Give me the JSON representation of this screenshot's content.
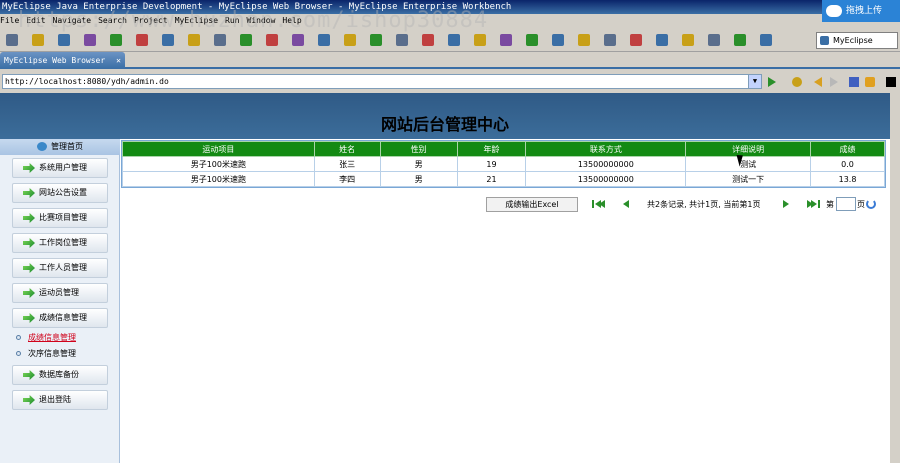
{
  "window": {
    "title": "MyEclipse Java Enterprise Development - MyEclipse Web Browser - MyEclipse Enterprise Workbench",
    "upload_label": "拖拽上传"
  },
  "menubar": [
    "File",
    "Edit",
    "Navigate",
    "Search",
    "Project",
    "MyEclipse",
    "Run",
    "Window",
    "Help"
  ],
  "toolbar": {
    "perspective_label": "MyEclipse"
  },
  "editor": {
    "tab_label": "MyEclipse Web Browser",
    "close_glyph": "✕"
  },
  "browser": {
    "url": "http://localhost:8080/ydh/admin.do"
  },
  "watermark": "https://www.huzhan.com/ishop30884",
  "page": {
    "title": "网站后台管理中心"
  },
  "sidebar": {
    "home_label": "管理首页",
    "menu_items": [
      {
        "label": "系统用户管理"
      },
      {
        "label": "网站公告设置"
      },
      {
        "label": "比赛项目管理"
      },
      {
        "label": "工作岗位管理"
      },
      {
        "label": "工作人员管理"
      },
      {
        "label": "运动员管理"
      },
      {
        "label": "成绩信息管理"
      }
    ],
    "sub_items": [
      {
        "label": "成绩信息管理",
        "active": true
      },
      {
        "label": "次序信息管理",
        "active": false
      }
    ],
    "bottom_items": [
      {
        "label": "数据库备份"
      },
      {
        "label": "退出登陆"
      }
    ]
  },
  "table": {
    "columns": [
      "运动项目",
      "姓名",
      "性别",
      "年龄",
      "联系方式",
      "详细说明",
      "成绩"
    ],
    "rows": [
      [
        "男子100米速跑",
        "张三",
        "男",
        "19",
        "13500000000",
        "测试",
        "0.0"
      ],
      [
        "男子100米速跑",
        "李四",
        "男",
        "21",
        "13500000000",
        "测试一下",
        "13.8"
      ]
    ]
  },
  "pager": {
    "export_label": "成绩输出Excel",
    "summary": "共2条记录, 共计1页, 当前第1页",
    "goto_prefix": "第",
    "goto_suffix": "页",
    "goto_value": ""
  },
  "colors": {
    "header_band": "#2f5a86",
    "table_header": "#138a13",
    "active_link": "#d0021b"
  }
}
